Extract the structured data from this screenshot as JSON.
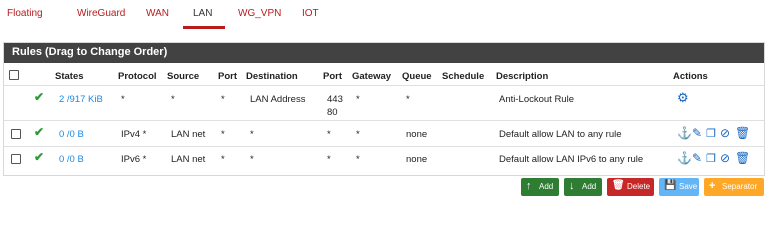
{
  "tabs": [
    {
      "label": "Floating"
    },
    {
      "label": "WireGuard"
    },
    {
      "label": "WAN"
    },
    {
      "label": "LAN"
    },
    {
      "label": "WG_VPN"
    },
    {
      "label": "IOT"
    }
  ],
  "panel": {
    "title": "Rules (Drag to Change Order)"
  },
  "table": {
    "headers": {
      "states": "States",
      "protocol": "Protocol",
      "source": "Source",
      "port": "Port",
      "destination": "Destination",
      "dport": "Port",
      "gateway": "Gateway",
      "queue": "Queue",
      "schedule": "Schedule",
      "description": "Description",
      "actions": "Actions"
    },
    "rows": [
      {
        "states": "2 /917 KiB",
        "protocol": "*",
        "source": "*",
        "port": "*",
        "destination": "LAN Address",
        "dport_line1": "443",
        "dport_line2": "80",
        "gateway": "*",
        "queue": "*",
        "schedule": "",
        "description": "Anti-Lockout Rule"
      },
      {
        "states": "0 /0 B",
        "protocol": "IPv4 *",
        "source": "LAN net",
        "port": "*",
        "destination": "*",
        "dport": "*",
        "gateway": "*",
        "queue": "none",
        "schedule": "",
        "description": "Default allow LAN to any rule"
      },
      {
        "states": "0 /0 B",
        "protocol": "IPv6 *",
        "source": "LAN net",
        "port": "*",
        "destination": "*",
        "dport": "*",
        "gateway": "*",
        "queue": "none",
        "schedule": "",
        "description": "Default allow LAN IPv6 to any rule"
      }
    ]
  },
  "buttons": {
    "add_top": "Add",
    "add_bottom": "Add",
    "delete": "Delete",
    "save": "Save",
    "separator": "Separator"
  },
  "colors": {
    "accent": "#b71c1c",
    "header_bg": "#424242",
    "pass_check": "#2e9b3a",
    "link": "#1e88e5",
    "btn_add": "#2e7d32",
    "btn_delete": "#c62828",
    "btn_save": "#64b5f6",
    "btn_separator": "#ffa726"
  }
}
